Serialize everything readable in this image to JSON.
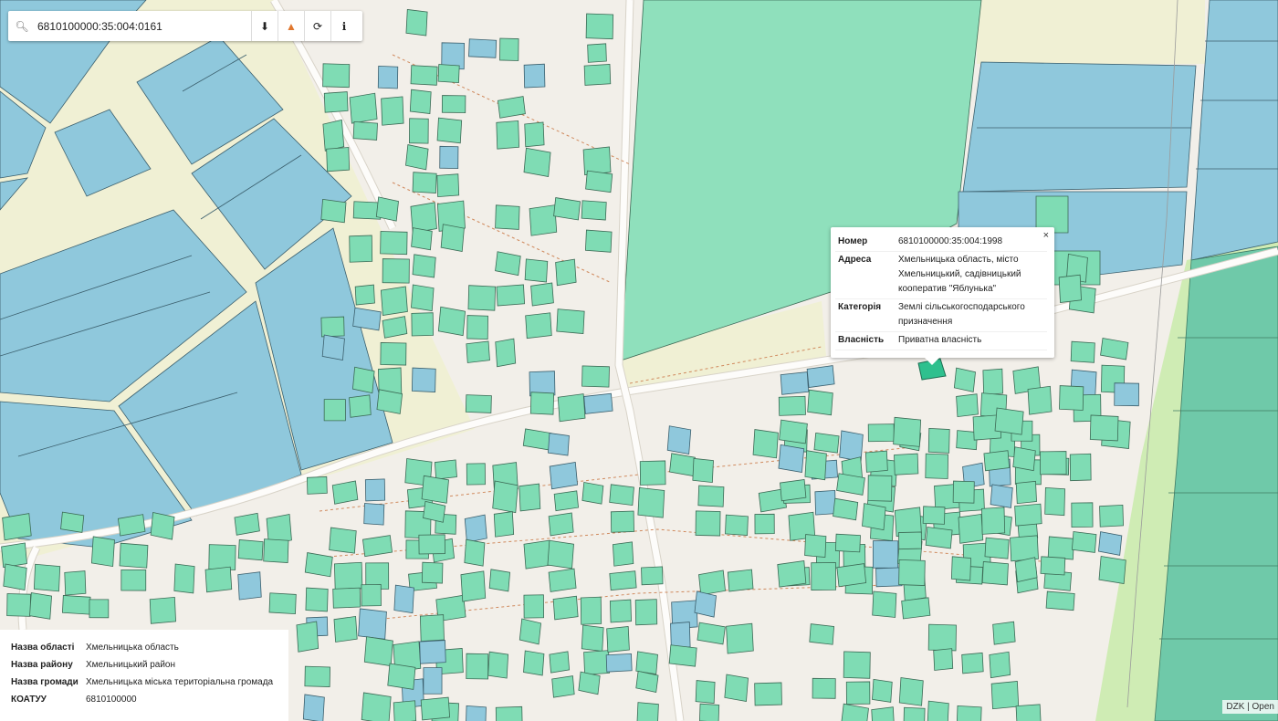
{
  "search": {
    "value": "6810100000:35:004:0161",
    "icon": "search-icon"
  },
  "toolbar": {
    "buttons": [
      {
        "name": "download",
        "icon": "download-icon",
        "glyph": "⬇"
      },
      {
        "name": "warning",
        "icon": "warning-icon",
        "glyph": "▲"
      },
      {
        "name": "refresh",
        "icon": "refresh-icon",
        "glyph": "⟳"
      },
      {
        "name": "info",
        "icon": "info-icon",
        "glyph": "ℹ"
      }
    ]
  },
  "popup": {
    "close_glyph": "×",
    "rows": [
      {
        "key": "Номер",
        "value": "6810100000:35:004:1998"
      },
      {
        "key": "Адреса",
        "value": "Хмельницька область, місто Хмельницький, садівницький кооператив \"Яблунька\""
      },
      {
        "key": "Категорія",
        "value": "Землі сільськогосподарського призначення"
      },
      {
        "key": "Власність",
        "value": "Приватна власність"
      }
    ]
  },
  "info_panel": {
    "rows": [
      {
        "key": "Назва області",
        "value": "Хмельницька область"
      },
      {
        "key": "Назва району",
        "value": "Хмельницький район"
      },
      {
        "key": "Назва громади",
        "value": "Хмельницька міська територіальна громада"
      },
      {
        "key": "КОАТУУ",
        "value": "6810100000"
      }
    ]
  },
  "attribution": "DZK | Open",
  "colors": {
    "parcel_green": "#7fdcb4",
    "parcel_blue": "#8fc8dc",
    "selected_parcel": "#2fc08e",
    "background": "#f2efe9"
  }
}
